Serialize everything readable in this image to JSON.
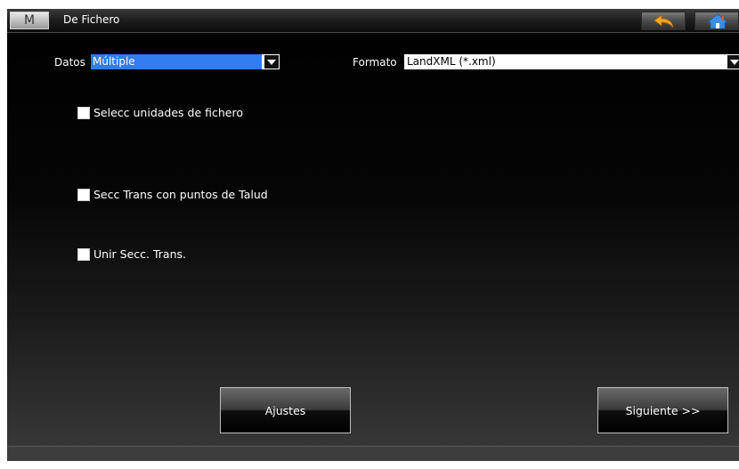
{
  "window": {
    "menu_button_label": "M",
    "title": "De Fichero"
  },
  "toolbar": {
    "back_icon": "back-arrow-icon",
    "home_icon": "home-icon",
    "colors": {
      "back_arrow": "#f5a623",
      "home": "#3a8ee6"
    }
  },
  "form": {
    "datos": {
      "label": "Datos",
      "value": "Múltiple"
    },
    "formato": {
      "label": "Formato",
      "value": "LandXML (*.xml)"
    },
    "checkboxes": [
      {
        "label": "Selecc unidades de fichero",
        "checked": false
      },
      {
        "label": "Secc Trans con puntos de Talud",
        "checked": false
      },
      {
        "label": "Unir Secc. Trans.",
        "checked": false
      }
    ]
  },
  "actions": {
    "ajustes_label": "Ajustes",
    "siguiente_label": "Siguiente >>"
  },
  "colors": {
    "selection": "#2f7df0",
    "background": "#000000"
  }
}
